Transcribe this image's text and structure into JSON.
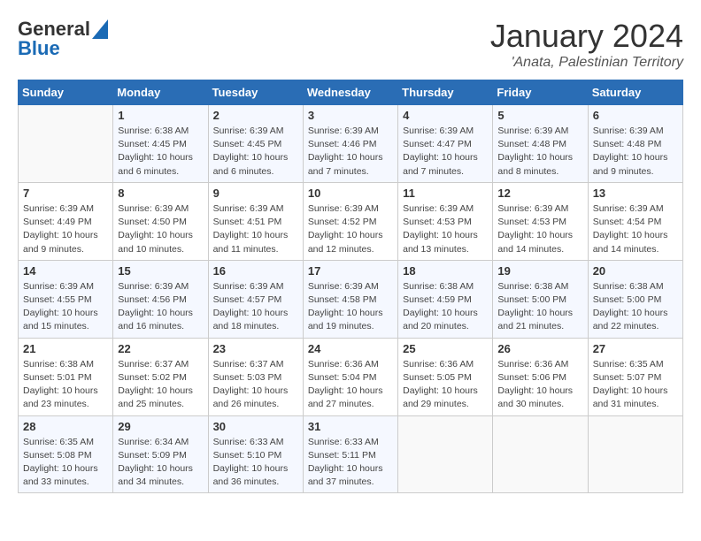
{
  "header": {
    "logo_line1": "General",
    "logo_line2": "Blue",
    "main_title": "January 2024",
    "subtitle": "'Anata, Palestinian Territory"
  },
  "calendar": {
    "days_of_week": [
      "Sunday",
      "Monday",
      "Tuesday",
      "Wednesday",
      "Thursday",
      "Friday",
      "Saturday"
    ],
    "weeks": [
      [
        {
          "day": "",
          "info": ""
        },
        {
          "day": "1",
          "info": "Sunrise: 6:38 AM\nSunset: 4:45 PM\nDaylight: 10 hours\nand 6 minutes."
        },
        {
          "day": "2",
          "info": "Sunrise: 6:39 AM\nSunset: 4:45 PM\nDaylight: 10 hours\nand 6 minutes."
        },
        {
          "day": "3",
          "info": "Sunrise: 6:39 AM\nSunset: 4:46 PM\nDaylight: 10 hours\nand 7 minutes."
        },
        {
          "day": "4",
          "info": "Sunrise: 6:39 AM\nSunset: 4:47 PM\nDaylight: 10 hours\nand 7 minutes."
        },
        {
          "day": "5",
          "info": "Sunrise: 6:39 AM\nSunset: 4:48 PM\nDaylight: 10 hours\nand 8 minutes."
        },
        {
          "day": "6",
          "info": "Sunrise: 6:39 AM\nSunset: 4:48 PM\nDaylight: 10 hours\nand 9 minutes."
        }
      ],
      [
        {
          "day": "7",
          "info": "Sunrise: 6:39 AM\nSunset: 4:49 PM\nDaylight: 10 hours\nand 9 minutes."
        },
        {
          "day": "8",
          "info": "Sunrise: 6:39 AM\nSunset: 4:50 PM\nDaylight: 10 hours\nand 10 minutes."
        },
        {
          "day": "9",
          "info": "Sunrise: 6:39 AM\nSunset: 4:51 PM\nDaylight: 10 hours\nand 11 minutes."
        },
        {
          "day": "10",
          "info": "Sunrise: 6:39 AM\nSunset: 4:52 PM\nDaylight: 10 hours\nand 12 minutes."
        },
        {
          "day": "11",
          "info": "Sunrise: 6:39 AM\nSunset: 4:53 PM\nDaylight: 10 hours\nand 13 minutes."
        },
        {
          "day": "12",
          "info": "Sunrise: 6:39 AM\nSunset: 4:53 PM\nDaylight: 10 hours\nand 14 minutes."
        },
        {
          "day": "13",
          "info": "Sunrise: 6:39 AM\nSunset: 4:54 PM\nDaylight: 10 hours\nand 14 minutes."
        }
      ],
      [
        {
          "day": "14",
          "info": "Sunrise: 6:39 AM\nSunset: 4:55 PM\nDaylight: 10 hours\nand 15 minutes."
        },
        {
          "day": "15",
          "info": "Sunrise: 6:39 AM\nSunset: 4:56 PM\nDaylight: 10 hours\nand 16 minutes."
        },
        {
          "day": "16",
          "info": "Sunrise: 6:39 AM\nSunset: 4:57 PM\nDaylight: 10 hours\nand 18 minutes."
        },
        {
          "day": "17",
          "info": "Sunrise: 6:39 AM\nSunset: 4:58 PM\nDaylight: 10 hours\nand 19 minutes."
        },
        {
          "day": "18",
          "info": "Sunrise: 6:38 AM\nSunset: 4:59 PM\nDaylight: 10 hours\nand 20 minutes."
        },
        {
          "day": "19",
          "info": "Sunrise: 6:38 AM\nSunset: 5:00 PM\nDaylight: 10 hours\nand 21 minutes."
        },
        {
          "day": "20",
          "info": "Sunrise: 6:38 AM\nSunset: 5:00 PM\nDaylight: 10 hours\nand 22 minutes."
        }
      ],
      [
        {
          "day": "21",
          "info": "Sunrise: 6:38 AM\nSunset: 5:01 PM\nDaylight: 10 hours\nand 23 minutes."
        },
        {
          "day": "22",
          "info": "Sunrise: 6:37 AM\nSunset: 5:02 PM\nDaylight: 10 hours\nand 25 minutes."
        },
        {
          "day": "23",
          "info": "Sunrise: 6:37 AM\nSunset: 5:03 PM\nDaylight: 10 hours\nand 26 minutes."
        },
        {
          "day": "24",
          "info": "Sunrise: 6:36 AM\nSunset: 5:04 PM\nDaylight: 10 hours\nand 27 minutes."
        },
        {
          "day": "25",
          "info": "Sunrise: 6:36 AM\nSunset: 5:05 PM\nDaylight: 10 hours\nand 29 minutes."
        },
        {
          "day": "26",
          "info": "Sunrise: 6:36 AM\nSunset: 5:06 PM\nDaylight: 10 hours\nand 30 minutes."
        },
        {
          "day": "27",
          "info": "Sunrise: 6:35 AM\nSunset: 5:07 PM\nDaylight: 10 hours\nand 31 minutes."
        }
      ],
      [
        {
          "day": "28",
          "info": "Sunrise: 6:35 AM\nSunset: 5:08 PM\nDaylight: 10 hours\nand 33 minutes."
        },
        {
          "day": "29",
          "info": "Sunrise: 6:34 AM\nSunset: 5:09 PM\nDaylight: 10 hours\nand 34 minutes."
        },
        {
          "day": "30",
          "info": "Sunrise: 6:33 AM\nSunset: 5:10 PM\nDaylight: 10 hours\nand 36 minutes."
        },
        {
          "day": "31",
          "info": "Sunrise: 6:33 AM\nSunset: 5:11 PM\nDaylight: 10 hours\nand 37 minutes."
        },
        {
          "day": "",
          "info": ""
        },
        {
          "day": "",
          "info": ""
        },
        {
          "day": "",
          "info": ""
        }
      ]
    ]
  }
}
